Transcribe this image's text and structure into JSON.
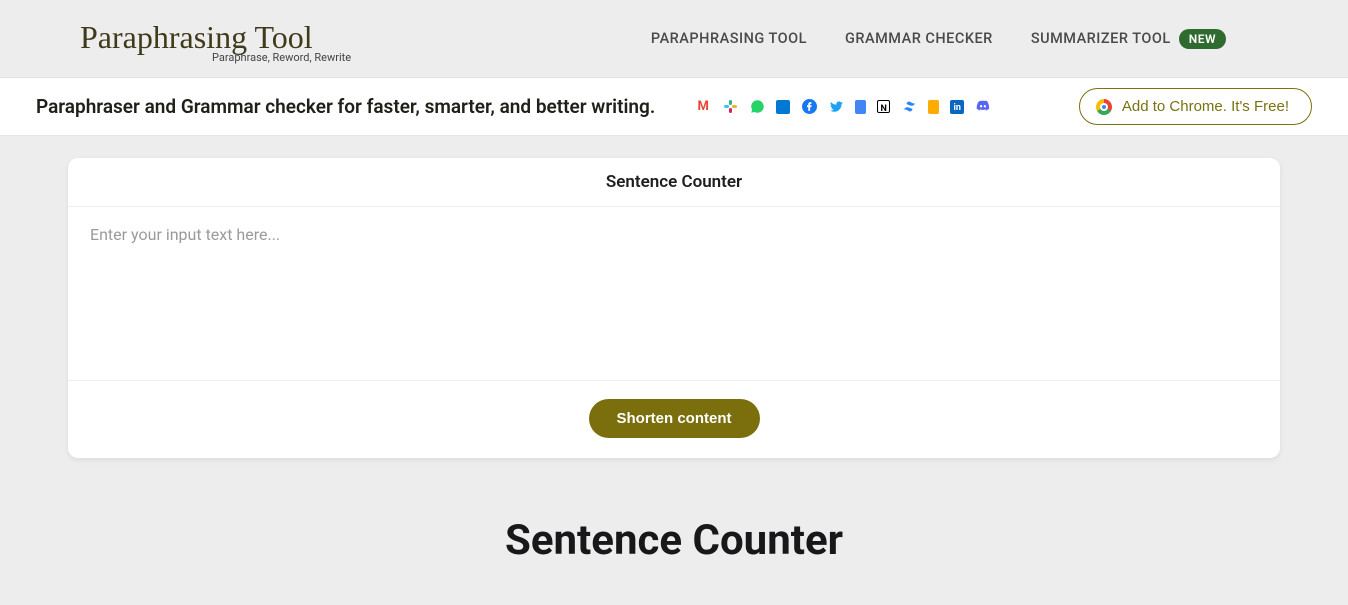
{
  "logo": {
    "title": "Paraphrasing Tool",
    "tagline": "Paraphrase, Reword, Rewrite"
  },
  "nav": {
    "items": [
      {
        "label": "PARAPHRASING TOOL"
      },
      {
        "label": "GRAMMAR CHECKER"
      },
      {
        "label": "SUMMARIZER TOOL",
        "badge": "NEW"
      }
    ]
  },
  "subbar": {
    "text": "Paraphraser and Grammar checker for faster, smarter, and better writing.",
    "chrome_button": "Add to Chrome. It's Free!",
    "icons": [
      {
        "name": "gmail"
      },
      {
        "name": "slack"
      },
      {
        "name": "whatsapp"
      },
      {
        "name": "outlook"
      },
      {
        "name": "facebook"
      },
      {
        "name": "twitter"
      },
      {
        "name": "google-docs"
      },
      {
        "name": "notion"
      },
      {
        "name": "confluence"
      },
      {
        "name": "jira"
      },
      {
        "name": "linkedin"
      },
      {
        "name": "discord"
      }
    ]
  },
  "card": {
    "title": "Sentence Counter",
    "placeholder": "Enter your input text here...",
    "value": "",
    "button": "Shorten content"
  },
  "page": {
    "heading": "Sentence Counter"
  }
}
